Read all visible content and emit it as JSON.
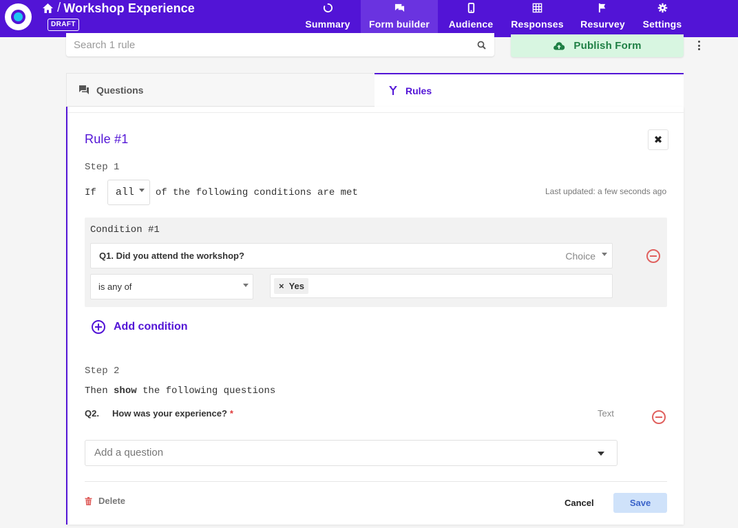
{
  "header": {
    "title": "Workshop Experience",
    "separator": "/",
    "status_badge": "DRAFT",
    "nav": [
      {
        "label": "Summary",
        "icon": "circle-progress-icon"
      },
      {
        "label": "Form builder",
        "icon": "chat-icon"
      },
      {
        "label": "Audience",
        "icon": "mobile-icon"
      },
      {
        "label": "Responses",
        "icon": "grid-icon"
      },
      {
        "label": "Resurvey",
        "icon": "flag-icon"
      },
      {
        "label": "Settings",
        "icon": "gear-icon"
      }
    ],
    "active_nav": "Form builder"
  },
  "search": {
    "placeholder": "Search 1 rule",
    "value": ""
  },
  "publish_label": "Publish Form",
  "tabs": [
    {
      "label": "Questions",
      "active": false
    },
    {
      "label": "Rules",
      "active": true
    }
  ],
  "rule": {
    "title": "Rule #1",
    "close_glyph": "✖",
    "step1_label": "Step 1",
    "if_prefix": "If",
    "match_mode": "all",
    "if_suffix": "of the following conditions are met",
    "last_updated": "Last updated: a few seconds ago",
    "conditions": [
      {
        "title": "Condition #1",
        "question": "Q1. Did you attend the workshop?",
        "question_type": "Choice",
        "operator": "is any of",
        "values": [
          "Yes"
        ]
      }
    ],
    "add_condition_label": "Add condition",
    "step2_label": "Step 2",
    "then_prefix": "Then",
    "then_action": "show",
    "then_suffix": "the following questions",
    "target_questions": [
      {
        "number": "Q2.",
        "text": "How was your experience?",
        "required_mark": "*",
        "type": "Text"
      }
    ],
    "add_question_placeholder": "Add a question",
    "delete_label": "Delete",
    "cancel_label": "Cancel",
    "save_label": "Save"
  },
  "colors": {
    "brand": "#5214d6",
    "accent_cyan": "#1ec5f0",
    "publish_bg": "#d8f6e1",
    "publish_text": "#1e7f44",
    "danger": "#e0605e",
    "save_bg": "#cfe2fa"
  }
}
